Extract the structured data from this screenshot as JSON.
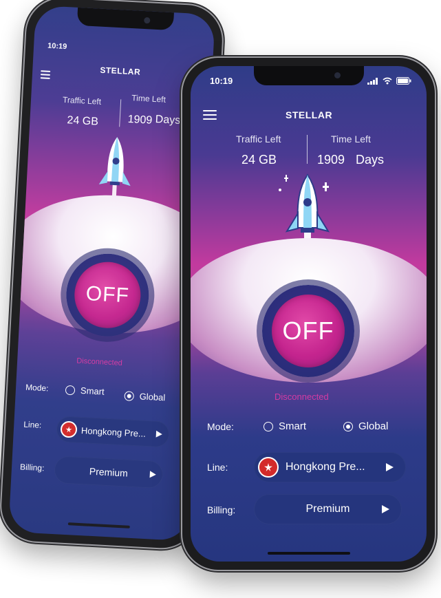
{
  "status": {
    "time": "10:19"
  },
  "app": {
    "title": "STELLAR"
  },
  "stats": {
    "traffic_label": "Traffic Left",
    "traffic_value": "24 GB",
    "time_label": "Time Left",
    "time_value": "1909",
    "time_unit": "Days"
  },
  "power": {
    "label": "OFF",
    "status": "Disconnected"
  },
  "mode": {
    "label": "Mode:",
    "options": [
      "Smart",
      "Global"
    ],
    "selected": "Global"
  },
  "line": {
    "label": "Line:",
    "value": "Hongkong Pre..."
  },
  "billing": {
    "label": "Billing:",
    "value": "Premium"
  },
  "colors": {
    "accent": "#d43aa3",
    "pill": "#25357d",
    "flag": "#d32a2a"
  }
}
